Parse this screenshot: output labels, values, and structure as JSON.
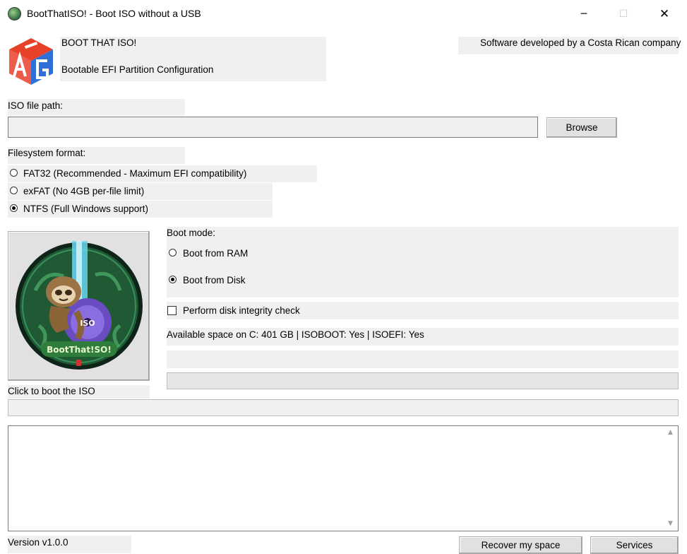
{
  "window": {
    "title": "BootThatISO! - Boot ISO without a USB",
    "minimize_glyph": "─",
    "maximize_glyph": "☐",
    "close_glyph": "✕"
  },
  "header": {
    "app_name": "BOOT THAT ISO!",
    "subtitle": "Bootable EFI Partition Configuration",
    "credits": "Software developed by a Costa Rican company",
    "logo_letters": "AG",
    "logo_colors": [
      "#e8412a",
      "#2f6fd8"
    ]
  },
  "iso": {
    "label": "ISO file path:",
    "value": "",
    "browse_label": "Browse"
  },
  "filesystem": {
    "label": "Filesystem format:",
    "options": [
      {
        "label": "FAT32 (Recommended - Maximum EFI compatibility)",
        "selected": false
      },
      {
        "label": "exFAT (No 4GB per-file limit)",
        "selected": false
      },
      {
        "label": "NTFS (Full Windows support)",
        "selected": true
      }
    ]
  },
  "boot_button": {
    "badge_text": "BootThat!SO!",
    "iso_text": "ISO",
    "caption": "Click to boot the ISO"
  },
  "boot_mode": {
    "label": "Boot mode:",
    "options": [
      {
        "label": "Boot from RAM",
        "selected": false
      },
      {
        "label": "Boot from Disk",
        "selected": true
      }
    ]
  },
  "integrity": {
    "label": "Perform disk integrity check",
    "checked": false
  },
  "status": {
    "space_text": "Available space on C: 401 GB | ISOBOOT: Yes | ISOEFI: Yes",
    "progress": 0
  },
  "log": {
    "content": "",
    "scroll_up_glyph": "▲",
    "scroll_down_glyph": "▼"
  },
  "footer": {
    "version": "Version v1.0.0",
    "recover_label": "Recover my space",
    "services_label": "Services"
  },
  "colors": {
    "panel": "#f0f0f0",
    "sloth_ring": "#3a8f5a",
    "badge_green": "#2e7d3a"
  }
}
